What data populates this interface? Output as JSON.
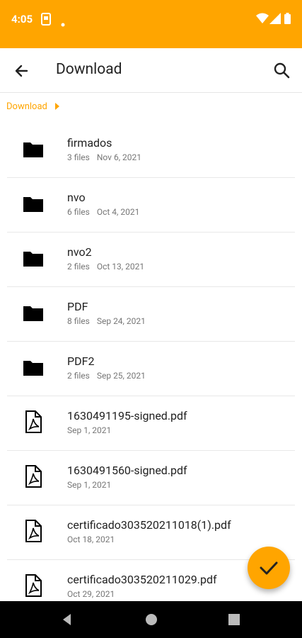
{
  "status": {
    "time": "4:05"
  },
  "appbar": {
    "title": "Download"
  },
  "breadcrumb": {
    "current": "Download"
  },
  "items": [
    {
      "name": "firmados",
      "count": "3 files",
      "date": "Nov 6, 2021",
      "type": "folder"
    },
    {
      "name": "nvo",
      "count": "6 files",
      "date": "Oct 4, 2021",
      "type": "folder"
    },
    {
      "name": "nvo2",
      "count": "2 files",
      "date": "Oct 13, 2021",
      "type": "folder"
    },
    {
      "name": "PDF",
      "count": "8 files",
      "date": "Sep 24, 2021",
      "type": "folder"
    },
    {
      "name": "PDF2",
      "count": "2 files",
      "date": "Sep 25, 2021",
      "type": "folder"
    },
    {
      "name": "1630491195-signed.pdf",
      "date": "Sep 1, 2021",
      "type": "pdf"
    },
    {
      "name": "1630491560-signed.pdf",
      "date": "Sep 1, 2021",
      "type": "pdf"
    },
    {
      "name": "certificado303520211018(1).pdf",
      "date": "Oct 18, 2021",
      "type": "pdf"
    },
    {
      "name": "certificado303520211029.pdf",
      "date": "Oct 29, 2021",
      "type": "pdf"
    }
  ],
  "colors": {
    "accent": "#FFA500"
  }
}
